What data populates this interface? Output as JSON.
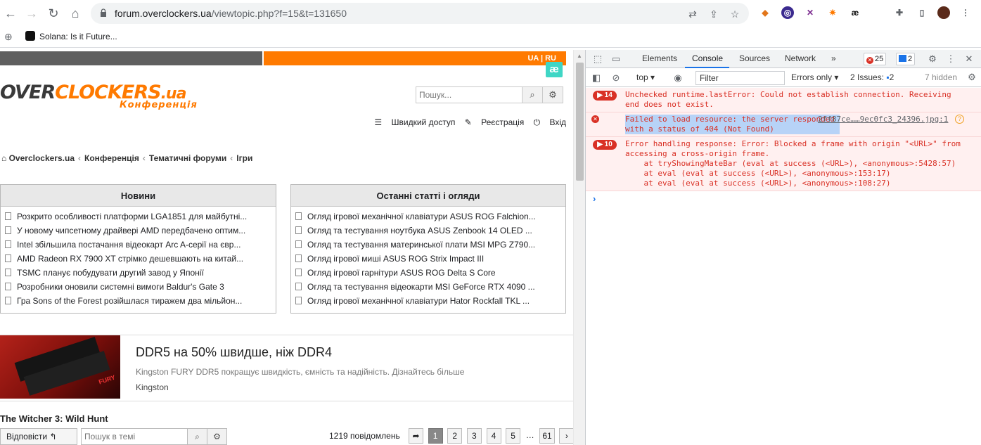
{
  "browser": {
    "url_host": "forum.overclockers.ua",
    "url_path": "/viewtopic.php?f=15&t=131650",
    "bookmark": "Solana: Is it Future..."
  },
  "page": {
    "langs": "UA | RU",
    "ae_badge": "æ",
    "logo": {
      "part1": "OVER",
      "part2": "CLOCKERS",
      "part3": ".ua",
      "sub": "Конференція"
    },
    "search_placeholder": "Пошук...",
    "quicklinks": {
      "quick": "Швидкий доступ",
      "register": "Реєстрація",
      "login": "Вхід"
    },
    "breadcrumb": [
      "Overclockers.ua",
      "Конференція",
      "Тематичні форуми",
      "Ігри"
    ],
    "news": {
      "title": "Новини",
      "items": [
        "Розкрито особливості платформи LGA1851 для майбутні...",
        "У новому чипсетному драйвері AMD передбачено оптим...",
        "Intel збільшила постачання відеокарт Arc A-серії на євр...",
        "AMD Radeon RX 7900 XT стрімко дешевшають на китай...",
        "TSMC планує побудувати другий завод у Японії",
        "Розробники оновили системні вимоги Baldur's Gate 3",
        "Гра Sons of the Forest розійшлася тиражем два мільйон..."
      ]
    },
    "articles": {
      "title": "Останні статті і огляди",
      "items": [
        "Огляд ігрової механічної клавіатури ASUS ROG Falchion...",
        "Огляд та тестування ноутбука ASUS Zenbook 14 OLED ...",
        "Огляд та тестування материнської плати MSI MPG Z790...",
        "Огляд ігрової миші ASUS ROG Strix Impact III",
        "Огляд ігрової гарнітури ASUS ROG Delta S Core",
        "Огляд та тестування відеокарти MSI GeForce RTX 4090 ...",
        "Огляд ігрової механічної клавіатури Hator Rockfall TKL ..."
      ]
    },
    "ad": {
      "title": "DDR5 на 50% швидше, ніж DDR4",
      "desc": "Kingston FURY DDR5 покращує швидкість, ємність та надійність. Дізнайтесь більше",
      "brand": "Kingston",
      "img_text": "FURY"
    },
    "topic_title": "The Witcher 3: Wild Hunt",
    "reply_label": "Відповісти",
    "topic_search_placeholder": "Пошук в темі",
    "msg_count": "1219 повідомлень",
    "pages": [
      "1",
      "2",
      "3",
      "4",
      "5",
      "…",
      "61"
    ]
  },
  "devtools": {
    "tabs": [
      "Elements",
      "Console",
      "Sources",
      "Network"
    ],
    "active_tab": "Console",
    "errors_badge": "25",
    "issues_badge": "2",
    "context": "top",
    "filter_placeholder": "Filter",
    "level": "Errors only",
    "issues_label": "2 Issues:",
    "issues_count": "2",
    "hidden": "7 hidden",
    "messages": [
      {
        "count": "14",
        "text": "Unchecked runtime.lastError: Could not establish connection. Receiving\nend does not exist."
      },
      {
        "text_sel": "Failed to load resource: the server responded \nwith a status of 404 (Not Found)",
        "source": "2ff87ce……9ec0fc3_24396.jpg:1"
      },
      {
        "count": "10",
        "text": "Error handling response: Error: Blocked a frame with origin \"<URL>\" from\naccessing a cross-origin frame.\n    at tryShowingMateBar (eval at success (<URL>), <anonymous>:5428:57)\n    at eval (eval at success (<URL>), <anonymous>:153:17)\n    at eval (eval at success (<URL>), <anonymous>:108:27)"
      }
    ],
    "prompt": "›"
  },
  "colors": {
    "brand_orange": "#ff7a00",
    "error_red": "#d93025",
    "devtools_blue": "#1a73e8"
  }
}
